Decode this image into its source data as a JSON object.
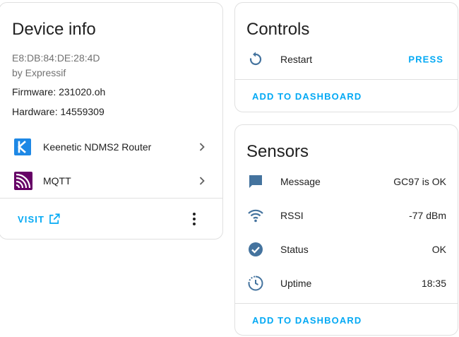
{
  "device_info": {
    "title": "Device info",
    "mac": "E8:DB:84:DE:28:4D",
    "manufacturer": "by Expressif",
    "firmware": "Firmware: 231020.oh",
    "hardware": "Hardware: 14559309",
    "integrations": [
      {
        "label": "Keenetic NDMS2 Router",
        "icon": "keenetic-logo-icon"
      },
      {
        "label": "MQTT",
        "icon": "mqtt-logo-icon"
      }
    ],
    "visit_label": "VISIT"
  },
  "controls": {
    "title": "Controls",
    "items": [
      {
        "label": "Restart",
        "icon": "restart-icon",
        "action_label": "PRESS"
      }
    ],
    "add_to_dashboard_label": "ADD TO DASHBOARD"
  },
  "sensors": {
    "title": "Sensors",
    "items": [
      {
        "label": "Message",
        "value": "GC97 is OK",
        "icon": "message-icon"
      },
      {
        "label": "RSSI",
        "value": "-77 dBm",
        "icon": "wifi-icon"
      },
      {
        "label": "Status",
        "value": "OK",
        "icon": "check-circle-icon"
      },
      {
        "label": "Uptime",
        "value": "18:35",
        "icon": "clock-icon"
      }
    ],
    "add_to_dashboard_label": "ADD TO DASHBOARD"
  },
  "colors": {
    "accent": "#03a9f4",
    "icon": "#44739e",
    "keenetic": "#1e88e5",
    "mqtt": "#660066",
    "divider": "#e0e0e0",
    "text_secondary": "#727272"
  }
}
